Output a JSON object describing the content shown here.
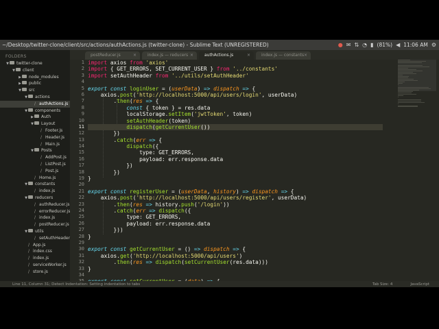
{
  "window": {
    "title": "~/Desktop/twitter-clone/client/src/actions/authActions.js (twitter-clone) - Sublime Text (UNREGISTERED)",
    "battery": "(81%)",
    "clock": "11:06 AM"
  },
  "sidebar": {
    "header": "FOLDERS",
    "items": [
      {
        "label": "twitter-clone",
        "depth": 0,
        "kind": "folder",
        "open": true
      },
      {
        "label": "client",
        "depth": 1,
        "kind": "folder",
        "open": true
      },
      {
        "label": "node_modules",
        "depth": 2,
        "kind": "folder",
        "open": false
      },
      {
        "label": "public",
        "depth": 2,
        "kind": "folder",
        "open": false
      },
      {
        "label": "src",
        "depth": 2,
        "kind": "folder",
        "open": true
      },
      {
        "label": "actions",
        "depth": 3,
        "kind": "folder",
        "open": true
      },
      {
        "label": "authActions.js",
        "depth": 4,
        "kind": "file",
        "selected": true
      },
      {
        "label": "components",
        "depth": 3,
        "kind": "folder",
        "open": true
      },
      {
        "label": "Auth",
        "depth": 4,
        "kind": "folder",
        "open": false
      },
      {
        "label": "Layout",
        "depth": 4,
        "kind": "folder",
        "open": true
      },
      {
        "label": "Footer.js",
        "depth": 5,
        "kind": "file"
      },
      {
        "label": "Header.js",
        "depth": 5,
        "kind": "file"
      },
      {
        "label": "Main.js",
        "depth": 5,
        "kind": "file"
      },
      {
        "label": "Posts",
        "depth": 4,
        "kind": "folder",
        "open": true
      },
      {
        "label": "AddPost.js",
        "depth": 5,
        "kind": "file"
      },
      {
        "label": "ListPost.js",
        "depth": 5,
        "kind": "file"
      },
      {
        "label": "Post.js",
        "depth": 5,
        "kind": "file"
      },
      {
        "label": "Home.js",
        "depth": 4,
        "kind": "file"
      },
      {
        "label": "constants",
        "depth": 3,
        "kind": "folder",
        "open": true
      },
      {
        "label": "index.js",
        "depth": 4,
        "kind": "file"
      },
      {
        "label": "reducers",
        "depth": 3,
        "kind": "folder",
        "open": true
      },
      {
        "label": "authReducer.js",
        "depth": 4,
        "kind": "file"
      },
      {
        "label": "errorReducer.js",
        "depth": 4,
        "kind": "file"
      },
      {
        "label": "index.js",
        "depth": 4,
        "kind": "file"
      },
      {
        "label": "postReducer.js",
        "depth": 4,
        "kind": "file"
      },
      {
        "label": "utils",
        "depth": 3,
        "kind": "folder",
        "open": true
      },
      {
        "label": "setAuthHeader.js",
        "depth": 4,
        "kind": "file"
      },
      {
        "label": "App.js",
        "depth": 3,
        "kind": "file"
      },
      {
        "label": "index.css",
        "depth": 3,
        "kind": "file"
      },
      {
        "label": "index.js",
        "depth": 3,
        "kind": "file"
      },
      {
        "label": "serviceWorker.js",
        "depth": 3,
        "kind": "file"
      },
      {
        "label": "store.js",
        "depth": 3,
        "kind": "file"
      }
    ]
  },
  "tabs": [
    {
      "label": "postReducer.js",
      "active": false
    },
    {
      "label": "index.js — reducers",
      "active": false
    },
    {
      "label": "authActions.js",
      "active": true
    },
    {
      "label": "index.js — constants",
      "active": false
    }
  ],
  "editor": {
    "current_line": 11,
    "lines": [
      [
        [
          "kw",
          "import "
        ],
        [
          "tx",
          "axios "
        ],
        [
          "kw",
          "from "
        ],
        [
          "st",
          "'axios'"
        ]
      ],
      [
        [
          "kw",
          "import "
        ],
        [
          "tx",
          "{ GET_ERRORS, SET_CURRENT_USER } "
        ],
        [
          "kw",
          "from "
        ],
        [
          "st",
          "'../constants'"
        ]
      ],
      [
        [
          "kw",
          "import "
        ],
        [
          "tx",
          "setAuthHeader "
        ],
        [
          "kw",
          "from "
        ],
        [
          "st",
          "'../utils/setAuthHeader'"
        ]
      ],
      [],
      [
        [
          "sb",
          "export const "
        ],
        [
          "fn",
          "loginUser"
        ],
        [
          "tx",
          " = ("
        ],
        [
          "pm",
          "userData"
        ],
        [
          "tx",
          ") "
        ],
        [
          "sb",
          "=> "
        ],
        [
          "pm",
          "dispatch"
        ],
        [
          "tx",
          " "
        ],
        [
          "sb",
          "=>"
        ],
        [
          "tx",
          " {"
        ]
      ],
      [
        [
          "tx",
          "    axios."
        ],
        [
          "fn",
          "post"
        ],
        [
          "tx",
          "("
        ],
        [
          "st",
          "'http://localhost:5000/api/users/login'"
        ],
        [
          "tx",
          ", userData)"
        ]
      ],
      [
        [
          "tx",
          "        ."
        ],
        [
          "fn",
          "then"
        ],
        [
          "tx",
          "("
        ],
        [
          "pm",
          "res"
        ],
        [
          "tx",
          " "
        ],
        [
          "sb",
          "=>"
        ],
        [
          "tx",
          " {"
        ]
      ],
      [
        [
          "tx",
          "            "
        ],
        [
          "sb",
          "const"
        ],
        [
          "tx",
          " { token } = res.data"
        ]
      ],
      [
        [
          "tx",
          "            localStorage."
        ],
        [
          "fn",
          "setItem"
        ],
        [
          "tx",
          "("
        ],
        [
          "st",
          "'jwtToken'"
        ],
        [
          "tx",
          ", token)"
        ]
      ],
      [
        [
          "tx",
          "            "
        ],
        [
          "fn",
          "setAuthHeader"
        ],
        [
          "tx",
          "(token)"
        ]
      ],
      [
        [
          "tx",
          "            "
        ],
        [
          "fn",
          "dispatch"
        ],
        [
          "tx",
          "("
        ],
        [
          "fn",
          "getCurrentUser"
        ],
        [
          "tx",
          "())"
        ]
      ],
      [
        [
          "tx",
          "        })"
        ]
      ],
      [
        [
          "tx",
          "        ."
        ],
        [
          "fn",
          "catch"
        ],
        [
          "tx",
          "("
        ],
        [
          "pm",
          "err"
        ],
        [
          "tx",
          " "
        ],
        [
          "sb",
          "=>"
        ],
        [
          "tx",
          " {"
        ]
      ],
      [
        [
          "tx",
          "            "
        ],
        [
          "fn",
          "dispatch"
        ],
        [
          "tx",
          "({"
        ]
      ],
      [
        [
          "tx",
          "                type: GET_ERRORS,"
        ]
      ],
      [
        [
          "tx",
          "                payload: err.response.data"
        ]
      ],
      [
        [
          "tx",
          "            })"
        ]
      ],
      [
        [
          "tx",
          "        })"
        ]
      ],
      [
        [
          "tx",
          "}"
        ]
      ],
      [],
      [
        [
          "sb",
          "export const "
        ],
        [
          "fn",
          "registerUser"
        ],
        [
          "tx",
          " = ("
        ],
        [
          "pm",
          "userData"
        ],
        [
          "tx",
          ", "
        ],
        [
          "pm",
          "history"
        ],
        [
          "tx",
          ") "
        ],
        [
          "sb",
          "=> "
        ],
        [
          "pm",
          "dispatch"
        ],
        [
          "tx",
          " "
        ],
        [
          "sb",
          "=>"
        ],
        [
          "tx",
          " {"
        ]
      ],
      [
        [
          "tx",
          "    axios."
        ],
        [
          "fn",
          "post"
        ],
        [
          "tx",
          "("
        ],
        [
          "st",
          "'http://localhost:5000/api/users/register'"
        ],
        [
          "tx",
          ", userData)"
        ]
      ],
      [
        [
          "tx",
          "        ."
        ],
        [
          "fn",
          "then"
        ],
        [
          "tx",
          "("
        ],
        [
          "pm",
          "res"
        ],
        [
          "tx",
          " "
        ],
        [
          "sb",
          "=>"
        ],
        [
          "tx",
          " history."
        ],
        [
          "fn",
          "push"
        ],
        [
          "tx",
          "("
        ],
        [
          "st",
          "'/login'"
        ],
        [
          "tx",
          "))"
        ]
      ],
      [
        [
          "tx",
          "        ."
        ],
        [
          "fn",
          "catch"
        ],
        [
          "tx",
          "("
        ],
        [
          "pm",
          "err"
        ],
        [
          "tx",
          " "
        ],
        [
          "sb",
          "=>"
        ],
        [
          "tx",
          " "
        ],
        [
          "fn",
          "dispatch"
        ],
        [
          "tx",
          "({"
        ]
      ],
      [
        [
          "tx",
          "            type: GET_ERRORS,"
        ]
      ],
      [
        [
          "tx",
          "            payload: err.response.data"
        ]
      ],
      [
        [
          "tx",
          "        }))"
        ]
      ],
      [
        [
          "tx",
          "}"
        ]
      ],
      [],
      [
        [
          "sb",
          "export const "
        ],
        [
          "fn",
          "getCurrentUser"
        ],
        [
          "tx",
          " = () "
        ],
        [
          "sb",
          "=> "
        ],
        [
          "pm",
          "dispatch"
        ],
        [
          "tx",
          " "
        ],
        [
          "sb",
          "=>"
        ],
        [
          "tx",
          " {"
        ]
      ],
      [
        [
          "tx",
          "    axios."
        ],
        [
          "fn",
          "get"
        ],
        [
          "tx",
          "("
        ],
        [
          "st",
          "'http://localhost:5000/api/users'"
        ],
        [
          "tx",
          ")"
        ]
      ],
      [
        [
          "tx",
          "        ."
        ],
        [
          "fn",
          "then"
        ],
        [
          "tx",
          "("
        ],
        [
          "pm",
          "res"
        ],
        [
          "tx",
          " "
        ],
        [
          "sb",
          "=>"
        ],
        [
          "tx",
          " "
        ],
        [
          "fn",
          "dispatch"
        ],
        [
          "tx",
          "("
        ],
        [
          "fn",
          "setCurrentUser"
        ],
        [
          "tx",
          "(res.data)))"
        ]
      ],
      [
        [
          "tx",
          "}"
        ]
      ],
      [],
      [
        [
          "sb",
          "export const "
        ],
        [
          "fn",
          "setCurrentUser"
        ],
        [
          "tx",
          " = ("
        ],
        [
          "pm",
          "data"
        ],
        [
          "tx",
          ") "
        ],
        [
          "sb",
          "=>"
        ],
        [
          "tx",
          " {"
        ]
      ]
    ]
  },
  "statusbar": {
    "left": "Line 11, Column 31; Detect Indentation: Setting indentation to tabs",
    "tab_size": "Tab Size: 4",
    "syntax": "JavaScript"
  }
}
